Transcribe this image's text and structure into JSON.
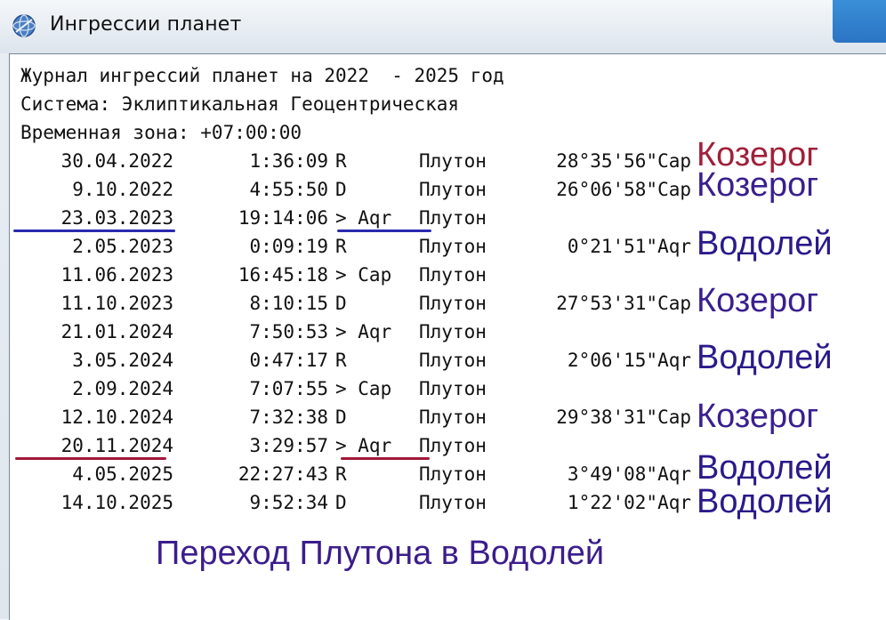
{
  "window": {
    "title": "Ингрессии планет"
  },
  "header": {
    "line1": "Журнал ингрессий планет на 2022  - 2025 год",
    "line2": "Система: Эклиптикальная Геоцентрическая",
    "line3": "Временная зона: +07:00:00"
  },
  "colors": {
    "kozerog_dark": "#a0203a",
    "kozerog_purple": "#3a1f8f",
    "vodoley": "#2a1a8a",
    "underline_blue": "#2a2ab0",
    "underline_red": "#a01838",
    "caption": "#3b1d8c"
  },
  "rows": [
    {
      "date": "30.04.2022",
      "time": "1:36:09",
      "flag": "R",
      "planet": "Плутон",
      "pos": "28°35'56\"Cap",
      "sign": "Козерог"
    },
    {
      "date": "9.10.2022",
      "time": "4:55:50",
      "flag": "D",
      "planet": "Плутон",
      "pos": "26°06'58\"Cap",
      "sign": "Козерог"
    },
    {
      "date": "23.03.2023",
      "time": "19:14:06",
      "flag": "> Aqr",
      "planet": "Плутон",
      "pos": "",
      "sign": ""
    },
    {
      "date": "2.05.2023",
      "time": "0:09:19",
      "flag": "R",
      "planet": "Плутон",
      "pos": "0°21'51\"Aqr",
      "sign": "Водолей"
    },
    {
      "date": "11.06.2023",
      "time": "16:45:18",
      "flag": "> Cap",
      "planet": "Плутон",
      "pos": "",
      "sign": ""
    },
    {
      "date": "11.10.2023",
      "time": "8:10:15",
      "flag": "D",
      "planet": "Плутон",
      "pos": "27°53'31\"Cap",
      "sign": "Козерог"
    },
    {
      "date": "21.01.2024",
      "time": "7:50:53",
      "flag": "> Aqr",
      "planet": "Плутон",
      "pos": "",
      "sign": ""
    },
    {
      "date": "3.05.2024",
      "time": "0:47:17",
      "flag": "R",
      "planet": "Плутон",
      "pos": "2°06'15\"Aqr",
      "sign": "Водолей"
    },
    {
      "date": "2.09.2024",
      "time": "7:07:55",
      "flag": "> Cap",
      "planet": "Плутон",
      "pos": "",
      "sign": ""
    },
    {
      "date": "12.10.2024",
      "time": "7:32:38",
      "flag": "D",
      "planet": "Плутон",
      "pos": "29°38'31\"Cap",
      "sign": "Козерог"
    },
    {
      "date": "20.11.2024",
      "time": "3:29:57",
      "flag": "> Aqr",
      "planet": "Плутон",
      "pos": "",
      "sign": ""
    },
    {
      "date": "4.05.2025",
      "time": "22:27:43",
      "flag": "R",
      "planet": "Плутон",
      "pos": "3°49'08\"Aqr",
      "sign": "Водолей"
    },
    {
      "date": "14.10.2025",
      "time": "9:52:34",
      "flag": "D",
      "planet": "Плутон",
      "pos": "1°22'02\"Aqr",
      "sign": "Водолей"
    }
  ],
  "caption": "Переход Плутона в Водолей"
}
